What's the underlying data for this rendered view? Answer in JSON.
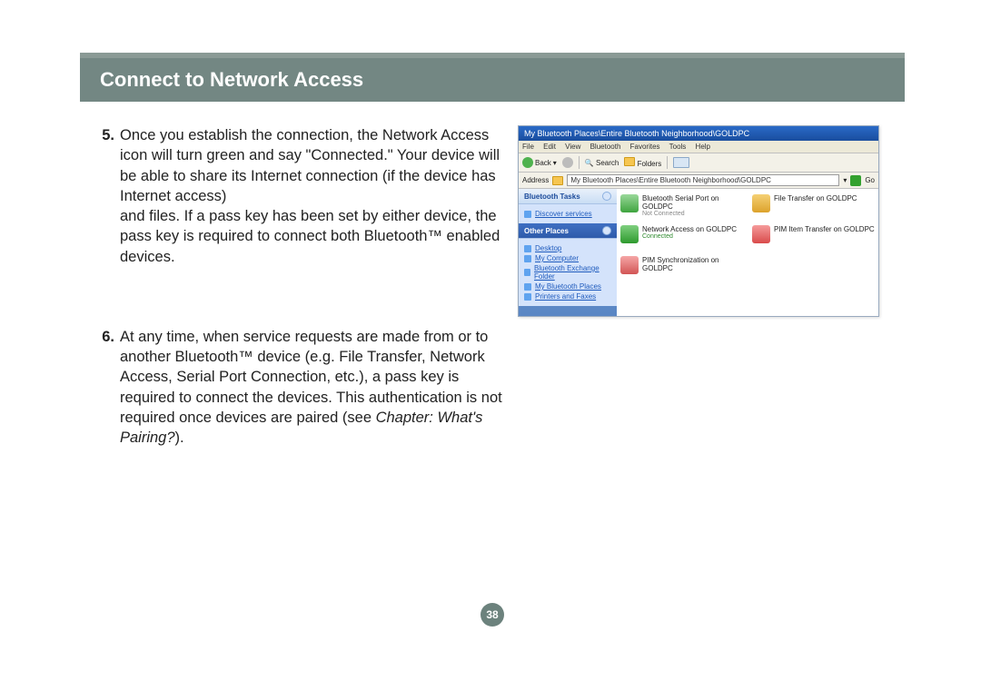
{
  "header": {
    "title": "Connect to Network Access"
  },
  "steps": [
    {
      "number": "5.",
      "text_a": "Once you establish the connection, the Network Access icon will turn green and say \"Connected.\" Your device will be able to share its Internet connection (if the device has Internet access)",
      "text_b": "and files. If a pass key has been set by either device, the pass key is required to connect both Bluetooth™ enabled devices."
    },
    {
      "number": "6.",
      "text_a": "At any time, when service requests are made from or to another Bluetooth™ device (e.g. File Transfer, Network Access, Serial Port Connection, etc.), a pass key is required to connect the devices. This authentication is not required once devices are paired (see ",
      "italic": "Chapter: What's Pairing?",
      "text_b": ")."
    }
  ],
  "page_number": "38",
  "window": {
    "title": "My Bluetooth Places\\Entire Bluetooth Neighborhood\\GOLDPC",
    "menu": [
      "File",
      "Edit",
      "View",
      "Bluetooth",
      "Favorites",
      "Tools",
      "Help"
    ],
    "toolbar": {
      "back": "Back",
      "search": "Search",
      "folders": "Folders"
    },
    "address_label": "Address",
    "address_value": "My Bluetooth Places\\Entire Bluetooth Neighborhood\\GOLDPC",
    "go": "Go",
    "side": {
      "tasks_header": "Bluetooth Tasks",
      "tasks_items": [
        "Discover services"
      ],
      "places_header": "Other Places",
      "places_items": [
        "Desktop",
        "My Computer",
        "Bluetooth Exchange Folder",
        "My Bluetooth Places",
        "Printers and Faxes"
      ]
    },
    "files": [
      {
        "name": "Bluetooth Serial Port on GOLDPC",
        "status": "Not Connected",
        "status_class": "grey",
        "icon": "ser"
      },
      {
        "name": "File Transfer on GOLDPC",
        "status": "",
        "status_class": "grey",
        "icon": "ft"
      },
      {
        "name": "Network Access on GOLDPC",
        "status": "Connected",
        "status_class": "green",
        "icon": "net"
      },
      {
        "name": "PIM Item Transfer on GOLDPC",
        "status": "",
        "status_class": "grey",
        "icon": "pim"
      },
      {
        "name": "PIM Synchronization on GOLDPC",
        "status": "",
        "status_class": "grey",
        "icon": "syn"
      }
    ]
  }
}
